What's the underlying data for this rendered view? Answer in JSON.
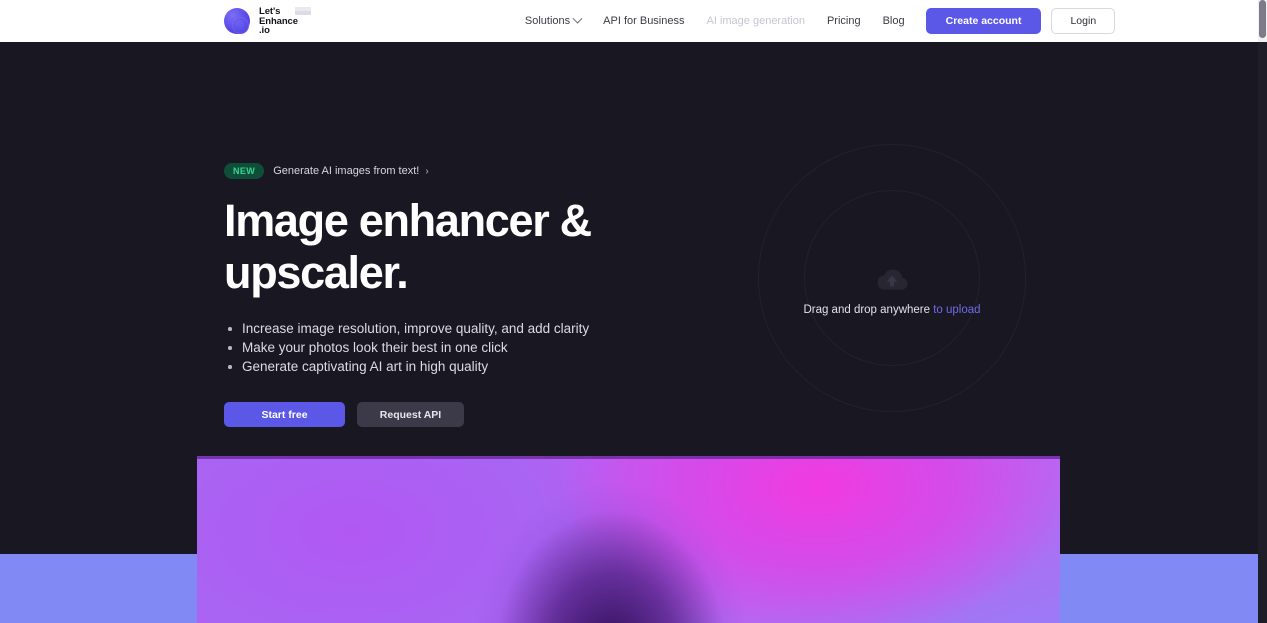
{
  "header": {
    "brand": {
      "line1": "Let's",
      "line2": "Enhance",
      "line3": ".io"
    },
    "nav": [
      {
        "label": "Solutions",
        "has_chevron": true,
        "dim": false
      },
      {
        "label": "API for Business",
        "has_chevron": false,
        "dim": false
      },
      {
        "label": "AI image generation",
        "has_chevron": false,
        "dim": true
      },
      {
        "label": "Pricing",
        "has_chevron": false,
        "dim": false
      },
      {
        "label": "Blog",
        "has_chevron": false,
        "dim": false
      }
    ],
    "create_account_label": "Create account",
    "login_label": "Login"
  },
  "hero": {
    "badge": {
      "tag": "NEW",
      "text": "Generate AI images from text!",
      "arrow": "›"
    },
    "title": "Image enhancer & upscaler.",
    "bullets": [
      "Increase image resolution, improve quality, and add clarity",
      "Make your photos look their best in one click",
      "Generate captivating AI art in high quality"
    ],
    "cta_primary": "Start free",
    "cta_secondary": "Request API"
  },
  "dropzone": {
    "text": "Drag and drop anywhere",
    "link": "to upload",
    "icon": "cloud-upload-icon"
  },
  "colors": {
    "accent": "#5b58e8",
    "background_dark": "#191722",
    "badge_green_bg": "#0e4e38",
    "badge_green_text": "#38d390",
    "bottom_band": "#8189f5",
    "link_purple": "#6f6ae8"
  }
}
